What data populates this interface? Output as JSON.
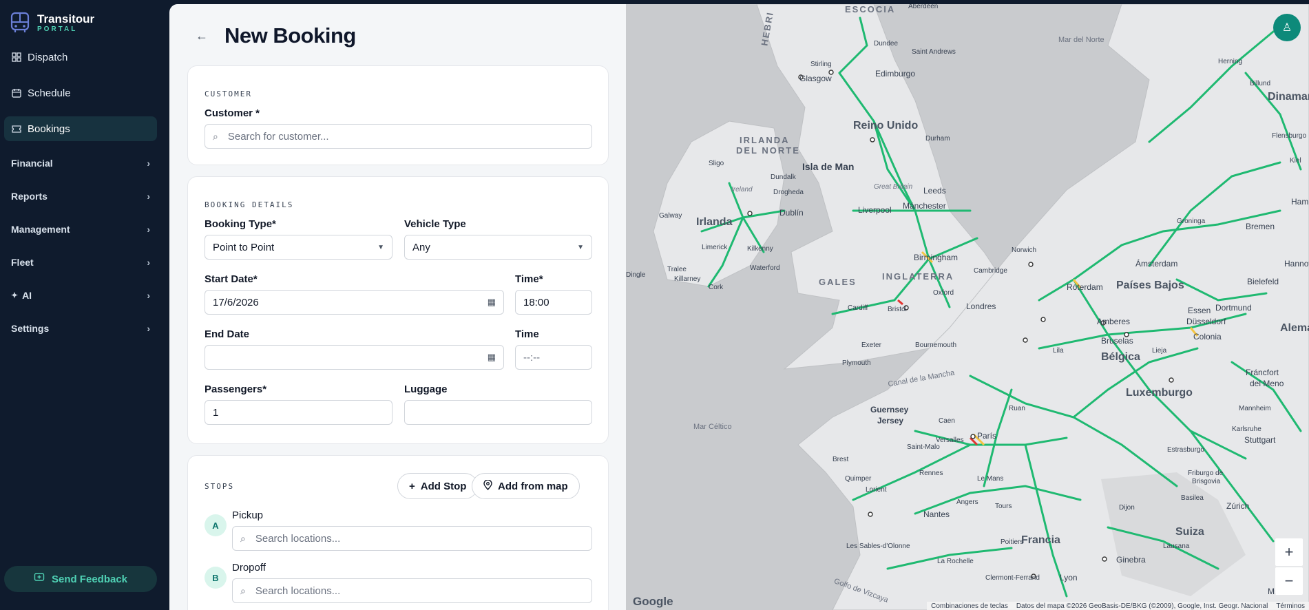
{
  "brand": {
    "name": "Transitour",
    "sub": "PORTAL"
  },
  "sidebar": {
    "items": [
      {
        "label": "Dispatch",
        "icon": "grid-icon"
      },
      {
        "label": "Schedule",
        "icon": "calendar-icon"
      },
      {
        "label": "Bookings",
        "icon": "ticket-icon",
        "active": true
      }
    ],
    "groups": [
      {
        "label": "Financial"
      },
      {
        "label": "Reports"
      },
      {
        "label": "Management"
      },
      {
        "label": "Fleet"
      },
      {
        "label": "AI"
      },
      {
        "label": "Settings"
      }
    ],
    "feedback_label": "Send Feedback"
  },
  "page": {
    "title": "New Booking"
  },
  "customer": {
    "section": "CUSTOMER",
    "label": "Customer *",
    "placeholder": "Search for customer..."
  },
  "booking": {
    "section": "BOOKING DETAILS",
    "booking_type_label": "Booking Type*",
    "booking_type_value": "Point to Point",
    "vehicle_type_label": "Vehicle Type",
    "vehicle_type_value": "Any",
    "start_date_label": "Start Date*",
    "start_date_value": "17/6/2026",
    "start_time_label": "Time*",
    "start_time_value": "18:00",
    "end_date_label": "End Date",
    "end_date_value": "",
    "end_time_label": "Time",
    "end_time_value": "--:--",
    "passengers_label": "Passengers*",
    "passengers_value": "1",
    "luggage_label": "Luggage",
    "luggage_value": ""
  },
  "stops": {
    "section": "STOPS",
    "add_stop_label": "Add Stop",
    "add_from_map_label": "Add from map",
    "items": [
      {
        "badge": "A",
        "label": "Pickup",
        "placeholder": "Search locations..."
      },
      {
        "badge": "B",
        "label": "Dropoff",
        "placeholder": "Search locations..."
      }
    ]
  },
  "map": {
    "labels": {
      "escocia": "ESCOCIA",
      "hebri": "HEBRI",
      "mar_del_norte": "Mar del Norte",
      "aberdeen": "Aberdeen",
      "dundee": "Dundee",
      "saint_andrews": "Saint Andrews",
      "stirling": "Stirling",
      "glasgow": "Glasgow",
      "edimburgo": "Edimburgo",
      "reino_unido": "Reino Unido",
      "durham": "Durham",
      "irlanda_del_norte_1": "IRLANDA",
      "irlanda_del_norte_2": "DEL NORTE",
      "isla_de_man": "Isla de Man",
      "sligo": "Sligo",
      "dundalk": "Dundalk",
      "great_britain": "Great Britain",
      "leeds": "Leeds",
      "ireland": "Ireland",
      "drogheda": "Drogheda",
      "liverpool": "Liverpool",
      "manchester": "Mánchester",
      "dublin": "Dublín",
      "galway": "Galway",
      "irlanda": "Irlanda",
      "limerick": "Limerick",
      "kilkenny": "Kilkenny",
      "birmingham": "Birmingham",
      "norwich": "Norwich",
      "dingle": "Dingle",
      "tralee": "Tralee",
      "waterford": "Waterford",
      "cambridge": "Cambridge",
      "killarney": "Killarney",
      "gales": "GALES",
      "inglaterra": "INGLATERRA",
      "cork": "Cork",
      "oxford": "Oxford",
      "londres": "Londres",
      "cardiff": "Cardiff",
      "bristol": "Bristol",
      "exeter": "Exeter",
      "bournemouth": "Bournemouth",
      "plymouth": "Plymouth",
      "canal_de_la_mancha": "Canal de la Mancha",
      "mar_celtico": "Mar Céltico",
      "guernsey": "Guernsey",
      "jersey": "Jersey",
      "dinamarca": "Dinamarca",
      "herning": "Herning",
      "billund": "Billund",
      "flensburgo": "Flensburgo",
      "kiel": "Kiel",
      "hamburgo": "Ham",
      "groninga": "Groninga",
      "bremen": "Bremen",
      "hannover": "Hannov",
      "amsterdam": "Ámsterdam",
      "roterdam": "Róterdam",
      "paises_bajos": "Países Bajos",
      "bielefeld": "Bielefeld",
      "essen": "Essen",
      "dortmund": "Dortmund",
      "amberes": "Amberes",
      "dusseldorf": "Düsseldorf",
      "aleman": "Alemar",
      "bruselas": "Bruselas",
      "colonia": "Colonia",
      "lila": "Lila",
      "lieja": "Lieja",
      "belgica": "Bélgica",
      "francfort_1": "Fráncfort",
      "francfort_2": "del Meno",
      "luxemburgo": "Luxemburgo",
      "mannheim": "Mannheim",
      "ruan": "Ruan",
      "karlsruhe": "Karlsruhe",
      "paris": "París",
      "stuttgart": "Stuttgart",
      "caen": "Caen",
      "versalles": "Versalles",
      "estrasburgo": "Estrasburgo",
      "friburgo_1": "Friburgo de",
      "friburgo_2": "Brisgovia",
      "saint_malo": "Saint-Malo",
      "brest": "Brest",
      "rennes": "Rennes",
      "le_mans": "Le Mans",
      "quimper": "Quimper",
      "lorient": "Lorient",
      "basilea": "Basilea",
      "zurich": "Zúrich",
      "dijon": "Dijon",
      "angers": "Angers",
      "tours": "Tours",
      "nantes": "Nantes",
      "francia": "Francia",
      "suiza": "Suiza",
      "poitiers": "Poitiers",
      "lausana": "Lausana",
      "les_sables": "Les Sables-d'Olonne",
      "la_rochelle": "La Rochelle",
      "ginebra": "Ginebra",
      "clermont": "Clermont-Ferrand",
      "lyon": "Lyon",
      "golfo": "Golfo de Vizcaya",
      "milan": "Milán"
    },
    "google": "Google",
    "attribution": {
      "shortcuts": "Combinaciones de teclas",
      "data": "Datos del mapa ©2026 GeoBasis-DE/BKG (©2009), Google, Inst. Geogr. Nacional",
      "terms": "Términos"
    },
    "zoom_in": "+",
    "zoom_out": "−"
  }
}
